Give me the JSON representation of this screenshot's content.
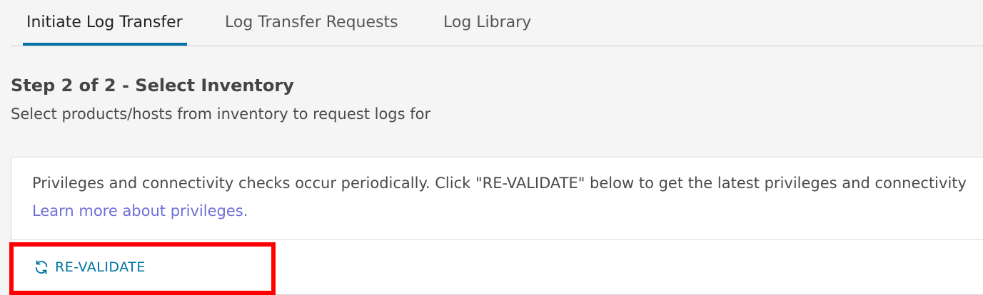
{
  "tabs": [
    {
      "label": "Initiate Log Transfer",
      "active": true
    },
    {
      "label": "Log Transfer Requests",
      "active": false
    },
    {
      "label": "Log Library",
      "active": false
    }
  ],
  "step": {
    "title": "Step 2 of 2 - Select Inventory",
    "subtitle": "Select products/hosts from inventory to request logs for"
  },
  "card": {
    "message": "Privileges and connectivity checks occur periodically. Click \"RE-VALIDATE\" below to get the latest privileges and connectivity",
    "link_label": "Learn more about privileges.",
    "revalidate_label": "RE-VALIDATE",
    "revalidate_icon": "refresh-icon"
  },
  "colors": {
    "accent": "#0072a3",
    "link": "#6c6fd6",
    "highlight": "#ff0000"
  }
}
